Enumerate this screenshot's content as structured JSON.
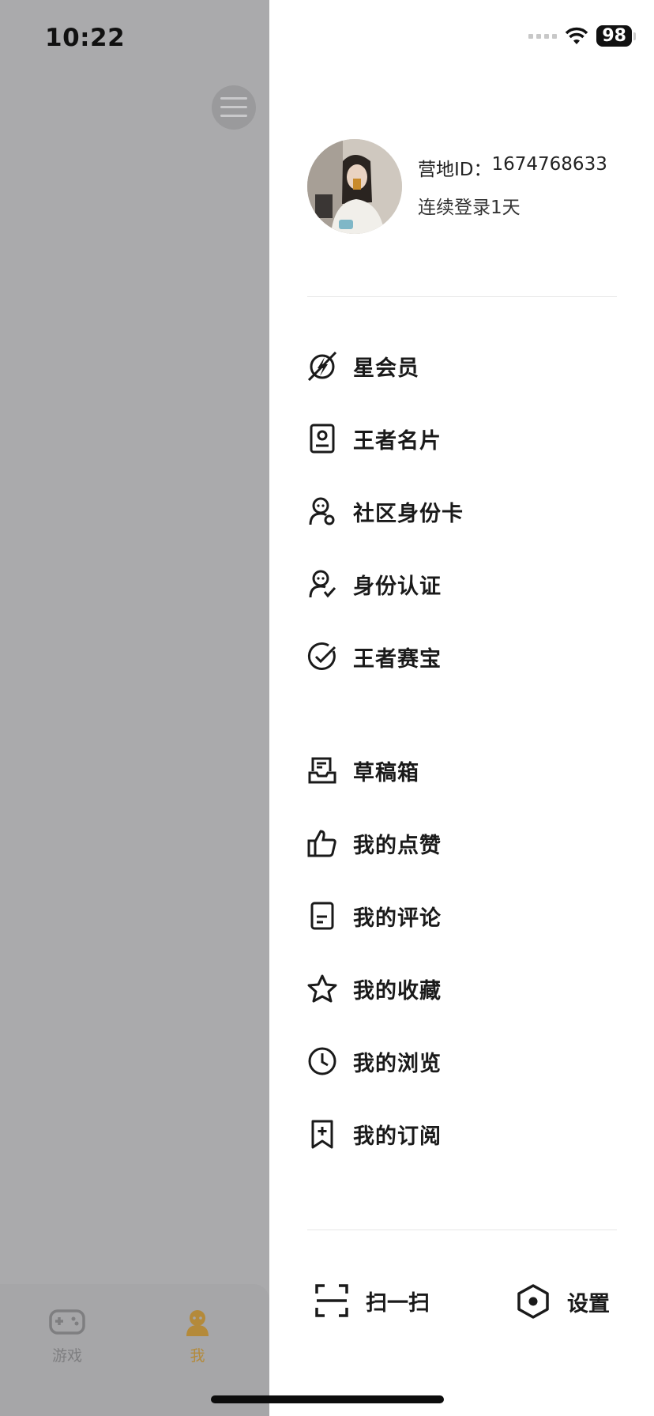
{
  "status_bar": {
    "time": "10:22",
    "battery": "98"
  },
  "profile": {
    "id_label": "营地ID：",
    "id_value": "1674768633",
    "login_text": "连续登录1天"
  },
  "menu_group_1": [
    {
      "label": "星会员",
      "icon": "star-member-icon"
    },
    {
      "label": "王者名片",
      "icon": "id-card-icon"
    },
    {
      "label": "社区身份卡",
      "icon": "community-identity-icon"
    },
    {
      "label": "身份认证",
      "icon": "identity-verification-icon"
    },
    {
      "label": "王者赛宝",
      "icon": "check-circle-icon"
    }
  ],
  "menu_group_2": [
    {
      "label": "草稿箱",
      "icon": "drafts-icon"
    },
    {
      "label": "我的点赞",
      "icon": "thumbs-up-icon"
    },
    {
      "label": "我的评论",
      "icon": "comment-doc-icon"
    },
    {
      "label": "我的收藏",
      "icon": "star-icon"
    },
    {
      "label": "我的浏览",
      "icon": "clock-icon"
    },
    {
      "label": "我的订阅",
      "icon": "bookmark-plus-icon"
    }
  ],
  "bottom_actions": {
    "scan_label": "扫一扫",
    "settings_label": "设置"
  },
  "bottom_tabs": [
    {
      "label": "游戏",
      "icon": "gamepad-icon"
    },
    {
      "label": "我",
      "icon": "user-icon"
    }
  ],
  "colors": {
    "overlay": "#aaaaac",
    "active_tab": "#b48a3a"
  }
}
